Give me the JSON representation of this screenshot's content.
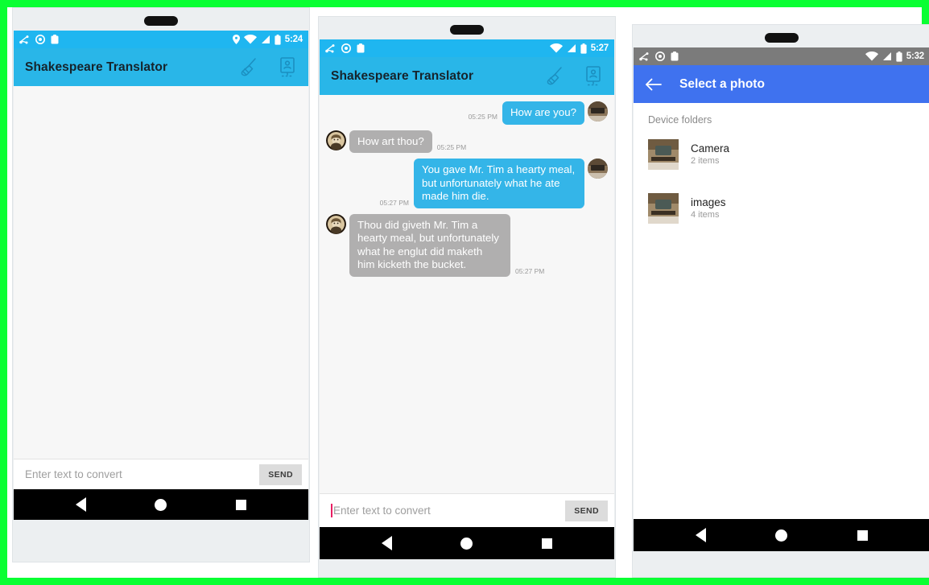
{
  "theme": {
    "border_green": "#0aff33",
    "appbar_cyan": "#29b6e8",
    "statusbar_cyan": "#1fb6f0",
    "statusbar_gray": "#7b7b7b",
    "picker_blue": "#3f72ef",
    "bubble_out": "#34b5e8",
    "bubble_in": "#b0afaf",
    "send_button_bg": "#dcdcdc",
    "caret_pink": "#e91e63",
    "chat_bg": "#f7f7f7"
  },
  "phone1": {
    "status_bar": {
      "time": "5:24",
      "icons_left": [
        "cast-icon",
        "record-circle-icon",
        "clipboard-icon"
      ],
      "icons_right": [
        "location-pin-icon",
        "wifi-icon",
        "signal-icon",
        "battery-icon"
      ]
    },
    "app_bar": {
      "title": "Shakespeare Translator",
      "actions": [
        "broom-icon",
        "device-contact-icon"
      ]
    },
    "chat": {
      "messages": []
    },
    "input": {
      "placeholder": "Enter text to convert",
      "value": "",
      "send_label": "SEND",
      "caret_visible": false
    },
    "nav_bar": [
      "back-icon",
      "home-icon",
      "recents-icon"
    ]
  },
  "phone2": {
    "status_bar": {
      "time": "5:27",
      "icons_left": [
        "cast-icon",
        "record-circle-icon",
        "clipboard-icon"
      ],
      "icons_right": [
        "wifi-icon",
        "signal-icon",
        "battery-icon"
      ]
    },
    "app_bar": {
      "title": "Shakespeare Translator",
      "actions": [
        "broom-icon",
        "device-contact-icon"
      ]
    },
    "chat": {
      "messages": [
        {
          "side": "out",
          "text": "How are you?",
          "time": "05:25 PM",
          "avatar": "user-photo-avatar"
        },
        {
          "side": "in",
          "text": "How art thou?",
          "time": "05:25 PM",
          "avatar": "shakespeare-avatar"
        },
        {
          "side": "out",
          "text": "You gave Mr. Tim a hearty meal, but unfortunately what he ate made him die.",
          "time": "05:27 PM",
          "avatar": "user-photo-avatar"
        },
        {
          "side": "in",
          "text": "Thou did giveth Mr. Tim a hearty meal,  but unfortunately what he englut did maketh him kicketh the bucket.",
          "time": "05:27 PM",
          "avatar": "shakespeare-avatar"
        }
      ]
    },
    "input": {
      "placeholder": "Enter text to convert",
      "value": "",
      "send_label": "SEND",
      "caret_visible": true
    },
    "nav_bar": [
      "back-icon",
      "home-icon",
      "recents-icon"
    ]
  },
  "phone3": {
    "status_bar": {
      "time": "5:32",
      "icons_left": [
        "cast-icon",
        "record-circle-icon",
        "clipboard-icon"
      ],
      "icons_right": [
        "wifi-icon",
        "signal-icon",
        "battery-icon"
      ]
    },
    "app_bar": {
      "back_icon": "arrow-left-icon",
      "title": "Select a photo"
    },
    "picker": {
      "section_label": "Device folders",
      "folders": [
        {
          "name": "Camera",
          "count": "2 items"
        },
        {
          "name": "images",
          "count": "4 items"
        }
      ]
    },
    "nav_bar": [
      "back-icon",
      "home-icon",
      "recents-icon"
    ]
  }
}
